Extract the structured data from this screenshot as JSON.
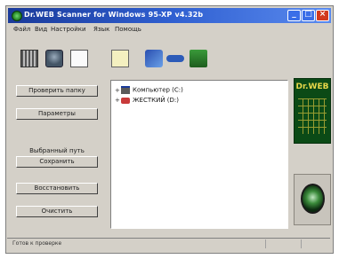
{
  "window": {
    "title": "Dr.WEB Scanner for Windows 95-XP v4.32b"
  },
  "menu": {
    "items": [
      "Файл",
      "Вид",
      "Настройки",
      "Язык",
      "Помощь"
    ]
  },
  "toolbar": {
    "icons": [
      "log-icon",
      "scan-icon",
      "new-document-icon",
      "edit-icon",
      "connect-icon",
      "link-icon",
      "update-icon"
    ]
  },
  "left_panel": {
    "scan_button": "Проверить папку",
    "settings_button": "Параметры",
    "group_label": "Выбранный путь",
    "save_button": "Сохранить",
    "restore_button": "Восстановить",
    "clear_button": "Очистить"
  },
  "tree": {
    "items": [
      {
        "label": "Компьютер (C:)",
        "icon": "hard-drive-icon"
      },
      {
        "label": "ЖЕСТКИЙ (D:)",
        "icon": "cdrom-icon"
      }
    ]
  },
  "logo": {
    "brand": "Dr.WEB"
  },
  "status": {
    "text": "Готов к проверке"
  }
}
